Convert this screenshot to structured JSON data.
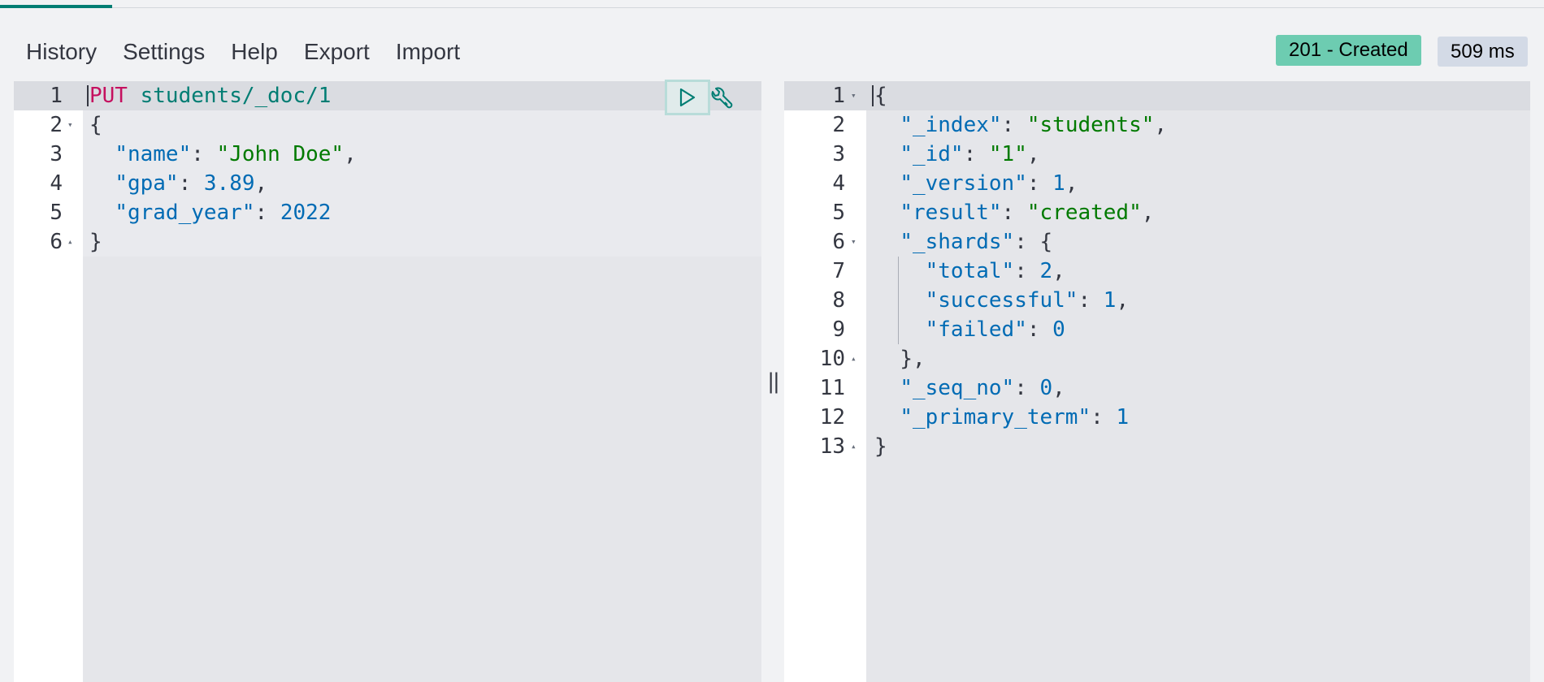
{
  "menu": {
    "items": [
      "History",
      "Settings",
      "Help",
      "Export",
      "Import"
    ]
  },
  "response_status": {
    "status": "201 - Created",
    "time": "509 ms"
  },
  "request_editor": {
    "lines": [
      {
        "num": "1",
        "fold": ""
      },
      {
        "num": "2",
        "fold": "▾"
      },
      {
        "num": "3",
        "fold": ""
      },
      {
        "num": "4",
        "fold": ""
      },
      {
        "num": "5",
        "fold": ""
      },
      {
        "num": "6",
        "fold": "▴"
      }
    ],
    "method": "PUT",
    "url": "students/_doc/1",
    "body": {
      "open": "{",
      "name_key": "\"name\"",
      "name_val": "\"John Doe\"",
      "gpa_key": "\"gpa\"",
      "gpa_val": "3.89",
      "grad_key": "\"grad_year\"",
      "grad_val": "2022",
      "close": "}"
    }
  },
  "response_editor": {
    "lines": [
      {
        "num": "1",
        "fold": "▾"
      },
      {
        "num": "2",
        "fold": ""
      },
      {
        "num": "3",
        "fold": ""
      },
      {
        "num": "4",
        "fold": ""
      },
      {
        "num": "5",
        "fold": ""
      },
      {
        "num": "6",
        "fold": "▾"
      },
      {
        "num": "7",
        "fold": ""
      },
      {
        "num": "8",
        "fold": ""
      },
      {
        "num": "9",
        "fold": ""
      },
      {
        "num": "10",
        "fold": "▴"
      },
      {
        "num": "11",
        "fold": ""
      },
      {
        "num": "12",
        "fold": ""
      },
      {
        "num": "13",
        "fold": "▴"
      }
    ],
    "json": {
      "open": "{",
      "index_key": "\"_index\"",
      "index_val": "\"students\"",
      "id_key": "\"_id\"",
      "id_val": "\"1\"",
      "version_key": "\"_version\"",
      "version_val": "1",
      "result_key": "\"result\"",
      "result_val": "\"created\"",
      "shards_key": "\"_shards\"",
      "total_key": "\"total\"",
      "total_val": "2",
      "successful_key": "\"successful\"",
      "successful_val": "1",
      "failed_key": "\"failed\"",
      "failed_val": "0",
      "shards_close": "},",
      "seq_key": "\"_seq_no\"",
      "seq_val": "0",
      "term_key": "\"_primary_term\"",
      "term_val": "1",
      "close": "}"
    }
  },
  "icons": {
    "run": "play-icon",
    "settings": "wrench-icon",
    "resizer": "drag-handle-icon"
  },
  "colors": {
    "accent": "#017d73",
    "status_success": "#6dccb1",
    "time_badge": "#d3dae6",
    "method": "#c5105f",
    "key": "#006bb4",
    "string": "#017a00"
  }
}
